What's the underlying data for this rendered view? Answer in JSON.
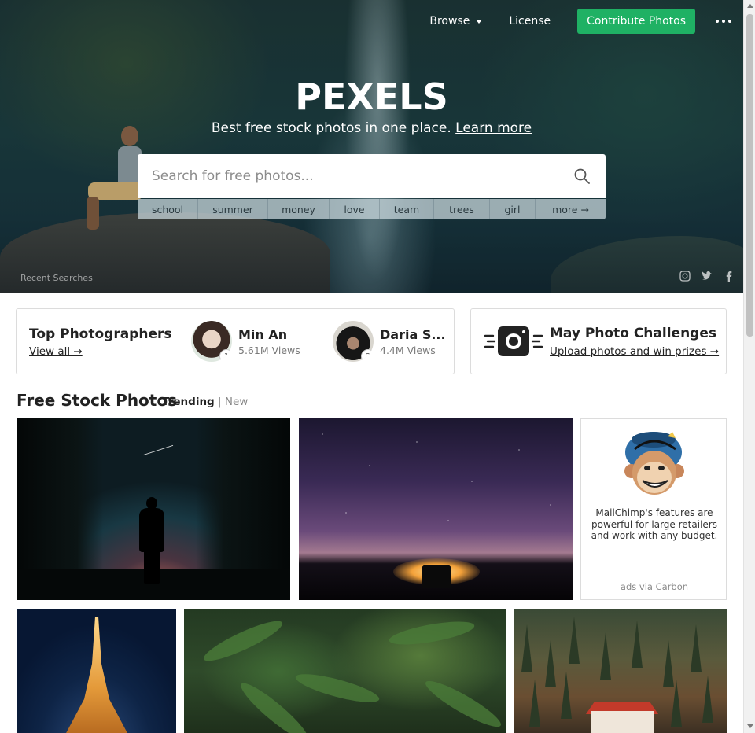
{
  "nav": {
    "browse_label": "Browse",
    "license_label": "License",
    "contribute_label": "Contribute Photos",
    "more_icon": "more-dots-icon"
  },
  "hero": {
    "logo": "PEXELS",
    "tagline": "Best free stock photos in one place.",
    "learn_more": "Learn more",
    "search_placeholder": "Search for free photos...",
    "search_value": "",
    "tags": [
      "school",
      "summer",
      "money",
      "love",
      "team",
      "trees",
      "girl",
      "more →"
    ],
    "recent_searches_label": "Recent Searches",
    "social_icons": [
      "instagram-icon",
      "twitter-icon",
      "facebook-icon"
    ]
  },
  "photographers": {
    "title": "Top Photographers",
    "view_all": "View all →",
    "items": [
      {
        "name": "Min An",
        "views": "5.61M Views",
        "rank": "1"
      },
      {
        "name": "Daria S...",
        "views": "4.4M Views",
        "rank": "2"
      }
    ]
  },
  "challenges": {
    "title": "May Photo Challenges",
    "link": "Upload photos and win prizes →"
  },
  "feed": {
    "title": "Free Stock Photos",
    "tab_trending": "Trending",
    "separator": "|",
    "tab_new": "New"
  },
  "ad": {
    "text": "MailChimp's features are powerful for large retailers and work with any budget.",
    "via": "ads via Carbon"
  },
  "colors": {
    "accent_green": "#1fb164",
    "text_dark": "#222222",
    "muted": "#7a7a7a"
  }
}
